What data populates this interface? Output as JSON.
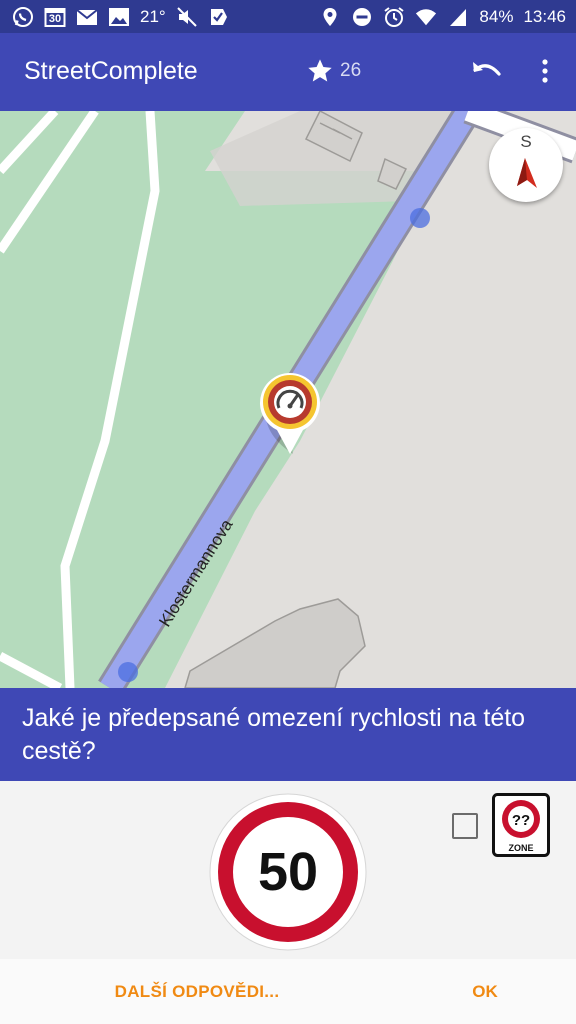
{
  "status_bar": {
    "temperature": "21°",
    "calendar_day": "30",
    "battery": "84%",
    "time": "13:46",
    "icons_left": [
      "whatsapp-icon",
      "calendar-icon",
      "mail-icon",
      "image-icon",
      "mute-icon",
      "tasks-icon"
    ],
    "icons_right": [
      "location-icon",
      "dnd-icon",
      "alarm-icon",
      "wifi-icon",
      "signal-icon"
    ]
  },
  "app_bar": {
    "title": "StreetComplete",
    "star_count": "26",
    "icons": [
      "star-icon",
      "undo-icon",
      "overflow-menu-icon"
    ]
  },
  "map": {
    "street_name": "Klostermannova",
    "compass_letter": "S",
    "quest_icon": "speed-limit-quest-icon"
  },
  "question": {
    "text": "Jaké je předepsané omezení rychlosti na této cestě?"
  },
  "answer": {
    "speed_value": "50",
    "zone_placeholder": "??",
    "zone_label": "ZONE",
    "zone_checked": false
  },
  "buttons": {
    "other_answers": "DALŠÍ ODPOVĚDI...",
    "ok": "OK"
  },
  "colors": {
    "status_bar": "#2f3a91",
    "primary": "#3f48b5",
    "accent": "#f08a13",
    "sign_red": "#c8102e",
    "road": "#9ba6ee"
  }
}
